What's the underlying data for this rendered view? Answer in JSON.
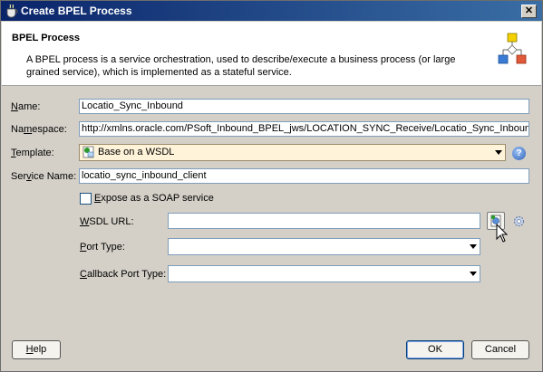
{
  "window": {
    "title": "Create BPEL Process",
    "close_glyph": "✕"
  },
  "header": {
    "title": "BPEL Process",
    "description": "A BPEL process is a service orchestration, used to describe/execute a business process (or large grained service), which is implemented as a stateful service.",
    "icon": "bpel-process-diagram-icon"
  },
  "form": {
    "name": {
      "label_pre": "",
      "label_ul": "N",
      "label_post": "ame:",
      "value": "Locatio_Sync_Inbound"
    },
    "namespace": {
      "label_pre": "Na",
      "label_ul": "m",
      "label_post": "espace:",
      "value": "http://xmlns.oracle.com/PSoft_Inbound_BPEL_jws/LOCATION_SYNC_Receive/Locatio_Sync_Inbound"
    },
    "template": {
      "label_pre": "",
      "label_ul": "T",
      "label_post": "emplate:",
      "value": "Base on a WSDL",
      "help_glyph": "?"
    },
    "service_name": {
      "label_pre": "Ser",
      "label_ul": "v",
      "label_post": "ice Name:",
      "value": "locatio_sync_inbound_client"
    },
    "expose_soap": {
      "label_pre": "",
      "label_ul": "E",
      "label_post": "xpose as a SOAP service",
      "checked": false
    },
    "wsdl_url": {
      "label_pre": "",
      "label_ul": "W",
      "label_post": "SDL URL:",
      "value": ""
    },
    "port_type": {
      "label_pre": "",
      "label_ul": "P",
      "label_post": "ort Type:",
      "value": ""
    },
    "callback_port_type": {
      "label_pre": "",
      "label_ul": "C",
      "label_post": "allback Port Type:",
      "value": ""
    }
  },
  "footer": {
    "help": {
      "label_pre": "",
      "label_ul": "H",
      "label_post": "elp"
    },
    "ok": {
      "label": "OK"
    },
    "cancel": {
      "label": "Cancel"
    }
  }
}
